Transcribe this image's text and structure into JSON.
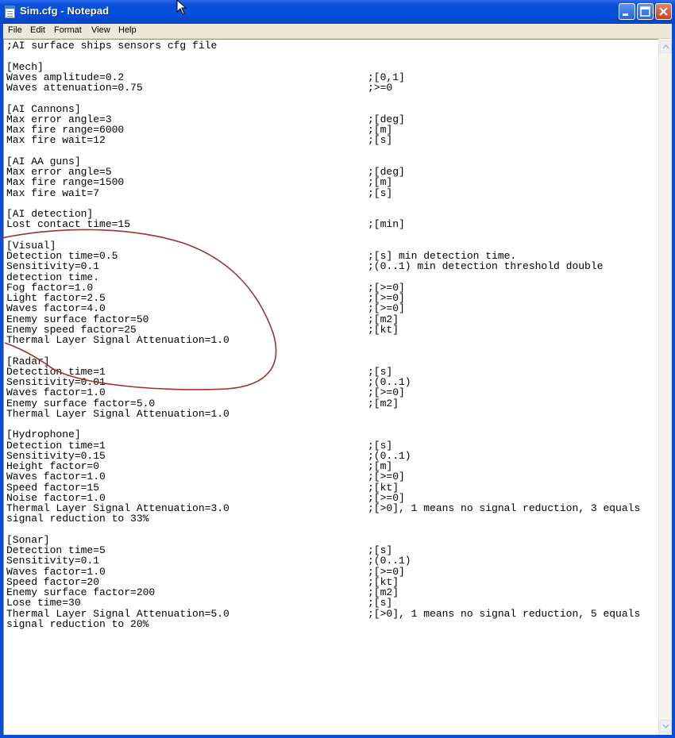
{
  "window": {
    "title": "Sim.cfg - Notepad"
  },
  "menu": [
    "File",
    "Edit",
    "Format",
    "View",
    "Help"
  ],
  "lines": [
    {
      "k": ";AI surface ships sensors cfg file",
      "c": ""
    },
    {
      "k": "",
      "c": ""
    },
    {
      "k": "[Mech]",
      "c": ""
    },
    {
      "k": "Waves amplitude=0.2",
      "c": ";[0,1]"
    },
    {
      "k": "Waves attenuation=0.75",
      "c": ";>=0"
    },
    {
      "k": "",
      "c": ""
    },
    {
      "k": "[AI Cannons]",
      "c": ""
    },
    {
      "k": "Max error angle=3",
      "c": ";[deg]"
    },
    {
      "k": "Max fire range=6000",
      "c": ";[m]"
    },
    {
      "k": "Max fire wait=12",
      "c": ";[s]"
    },
    {
      "k": "",
      "c": ""
    },
    {
      "k": "[AI AA guns]",
      "c": ""
    },
    {
      "k": "Max error angle=5",
      "c": ";[deg]"
    },
    {
      "k": "Max fire range=1500",
      "c": ";[m]"
    },
    {
      "k": "Max fire wait=7",
      "c": ";[s]"
    },
    {
      "k": "",
      "c": ""
    },
    {
      "k": "[AI detection]",
      "c": ""
    },
    {
      "k": "Lost contact time=15",
      "c": ";[min]"
    },
    {
      "k": "",
      "c": ""
    },
    {
      "k": "[Visual]",
      "c": ""
    },
    {
      "k": "Detection time=0.5",
      "c": ";[s] min detection time."
    },
    {
      "k": "Sensitivity=0.1",
      "c": ";(0..1) min detection threshold double"
    },
    {
      "k": "detection time.",
      "c": ""
    },
    {
      "k": "Fog factor=1.0",
      "c": ";[>=0]"
    },
    {
      "k": "Light factor=2.5",
      "c": ";[>=0]"
    },
    {
      "k": "Waves factor=4.0",
      "c": ";[>=0]"
    },
    {
      "k": "Enemy surface factor=50",
      "c": ";[m2]"
    },
    {
      "k": "Enemy speed factor=25",
      "c": ";[kt]"
    },
    {
      "k": "Thermal Layer Signal Attenuation=1.0",
      "c": ""
    },
    {
      "k": "",
      "c": ""
    },
    {
      "k": "[Radar]",
      "c": ""
    },
    {
      "k": "Detection time=1",
      "c": ";[s]"
    },
    {
      "k": "Sensitivity=0.01",
      "c": ";(0..1)"
    },
    {
      "k": "Waves factor=1.0",
      "c": ";[>=0]"
    },
    {
      "k": "Enemy surface factor=5.0",
      "c": ";[m2]"
    },
    {
      "k": "Thermal Layer Signal Attenuation=1.0",
      "c": ""
    },
    {
      "k": "",
      "c": ""
    },
    {
      "k": "[Hydrophone]",
      "c": ""
    },
    {
      "k": "Detection time=1",
      "c": ";[s]"
    },
    {
      "k": "Sensitivity=0.15",
      "c": ";(0..1)"
    },
    {
      "k": "Height factor=0",
      "c": ";[m]"
    },
    {
      "k": "Waves factor=1.0",
      "c": ";[>=0]"
    },
    {
      "k": "Speed factor=15",
      "c": ";[kt]"
    },
    {
      "k": "Noise factor=1.0",
      "c": ";[>=0]"
    },
    {
      "k": "Thermal Layer Signal Attenuation=3.0",
      "c": ";[>0], 1 means no signal reduction, 3 equals"
    },
    {
      "k": "signal reduction to 33%",
      "c": ""
    },
    {
      "k": "",
      "c": ""
    },
    {
      "k": "[Sonar]",
      "c": ""
    },
    {
      "k": "Detection time=5",
      "c": ";[s]"
    },
    {
      "k": "Sensitivity=0.1",
      "c": ";(0..1)"
    },
    {
      "k": "Waves factor=1.0",
      "c": ";[>=0]"
    },
    {
      "k": "Speed factor=20",
      "c": ";[kt]"
    },
    {
      "k": "Enemy surface factor=200",
      "c": ";[m2]"
    },
    {
      "k": "Lose time=30",
      "c": ";[s]"
    },
    {
      "k": "Thermal Layer Signal Attenuation=5.0",
      "c": ";[>0], 1 means no signal reduction, 5 equals"
    },
    {
      "k": "signal reduction to 20%",
      "c": ""
    }
  ],
  "colors": {
    "titlebar": "#0a4ed6",
    "menubar": "#ece9d8",
    "annotation": "#a0302a"
  },
  "icons": {
    "app": "notepad-icon",
    "minimize": "minimize-icon",
    "maximize": "maximize-icon",
    "close": "close-icon",
    "cursor": "mouse-cursor-icon"
  }
}
